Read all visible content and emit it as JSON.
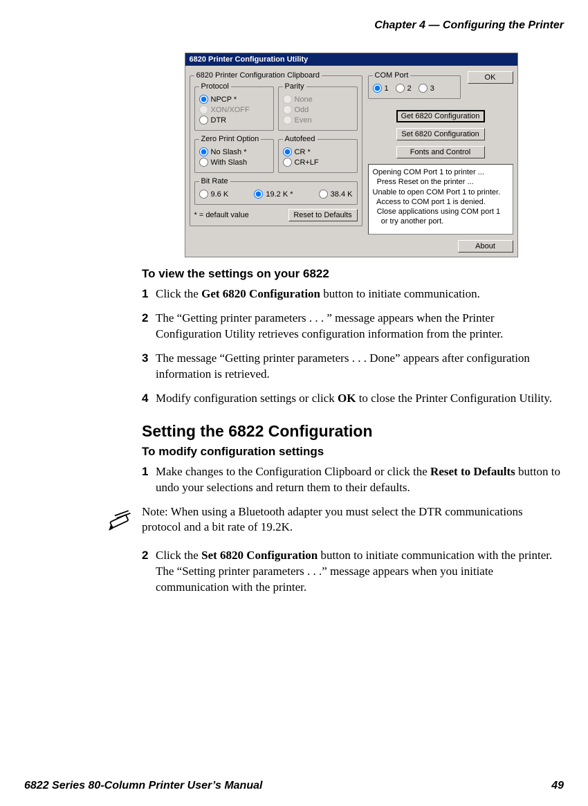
{
  "header": {
    "chapter": "Chapter 4 — Configuring the Printer"
  },
  "app": {
    "title": "6820 Printer Configuration Utility",
    "clipboard": {
      "legend": "6820 Printer Configuration Clipboard"
    },
    "protocol": {
      "legend": "Protocol",
      "options": [
        "NPCP *",
        "XON/XOFF",
        "DTR"
      ]
    },
    "parity": {
      "legend": "Parity",
      "options": [
        "None",
        "Odd",
        "Even"
      ]
    },
    "zero": {
      "legend": "Zero Print Option",
      "options": [
        "No Slash *",
        "With Slash"
      ]
    },
    "autofeed": {
      "legend": "Autofeed",
      "options": [
        "CR *",
        "CR+LF"
      ]
    },
    "bitrate": {
      "legend": "Bit Rate",
      "options": [
        "9.6 K",
        "19.2 K *",
        "38.4 K"
      ]
    },
    "comport": {
      "legend": "COM Port",
      "options": [
        "1",
        "2",
        "3"
      ]
    },
    "footnote": "* = default value",
    "buttons": {
      "ok": "OK",
      "get": "Get 6820 Configuration",
      "set": "Set 6820 Configuration",
      "fonts": "Fonts and Control",
      "reset": "Reset to Defaults",
      "about": "About"
    },
    "status": "Opening COM Port 1 to printer ...\n  Press Reset on the printer ...\nUnable to open COM Port 1 to printer.\n  Access to COM port 1 is denied.\n  Close applications using COM port 1\n    or try another port."
  },
  "doc": {
    "proc1": {
      "heading": "To view the settings on your 6822",
      "steps": [
        {
          "num": "1",
          "bold1": "Get 6820 Configuration"
        },
        {
          "num": "2",
          "text": "The “Getting printer parameters  . . . ” message appears when the Printer Configuration Utility retrieves configuration information from the printer."
        },
        {
          "num": "3",
          "text": "The message “Getting printer parameters  . . . Done” appears after configuration information is retrieved."
        },
        {
          "num": "4",
          "bold1": "OK"
        }
      ]
    },
    "section2": {
      "heading": "Setting the 6822 Configuration"
    },
    "proc2": {
      "heading": "To modify configuration settings",
      "steps": [
        {
          "num": "1",
          "bold1": "Reset to Defaults"
        },
        {
          "num": "2",
          "bold1": "Set 6820 Configuration"
        }
      ]
    },
    "note": "Note: When using a Bluetooth adapter you must select the DTR communications protocol and a bit rate of 19.2K."
  },
  "footer": {
    "title": "6822 Series 80-Column Printer User’s Manual",
    "page": "49"
  }
}
